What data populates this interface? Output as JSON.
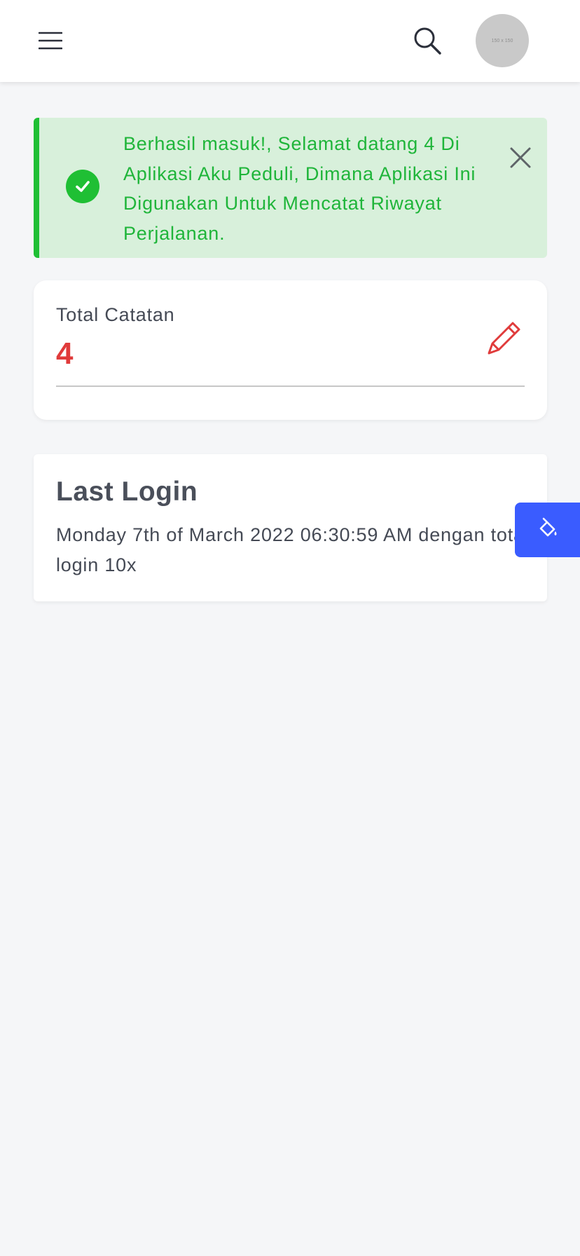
{
  "header": {
    "menu_icon": "hamburger-menu-icon",
    "search_icon": "search-icon",
    "avatar_placeholder": "150 x 150"
  },
  "alert": {
    "message": "Berhasil masuk!, Selamat datang 4 Di Aplikasi Aku Peduli, Dimana Aplikasi Ini Digunakan Untuk Mencatat Riwayat Perjalanan.",
    "status_icon": "check-circle-icon",
    "close_icon": "close-icon",
    "color": "#1fbf34",
    "background": "#d8f0db"
  },
  "stats": {
    "label": "Total Catatan",
    "value": "4",
    "icon": "pencil-icon",
    "value_color": "#e03b3b"
  },
  "last_login": {
    "title": "Last Login",
    "text": "Monday 7th of March 2022 06:30:59 AM dengan total login 10x"
  },
  "theme_button": {
    "icon": "paint-bucket-icon",
    "color": "#3a5cff"
  }
}
